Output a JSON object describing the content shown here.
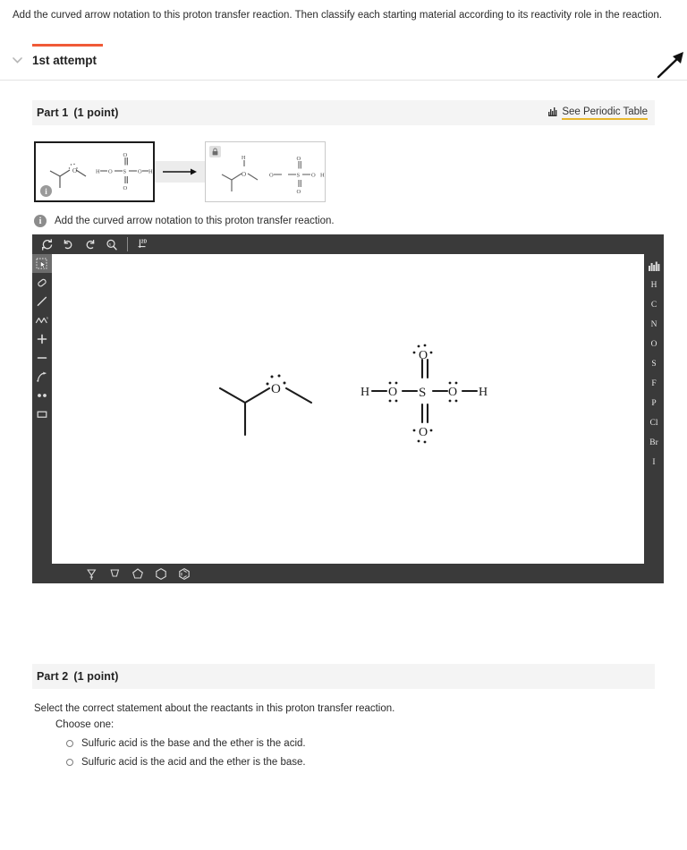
{
  "prompt": {
    "text": "Add the curved arrow notation to this proton transfer reaction. Then classify each starting material according to its reactivity role in the reaction."
  },
  "attempt": {
    "label": "1st attempt",
    "chevron_icon": "chevron-down-icon",
    "expand_icon": "expand-arrow-icon",
    "accent_color": "#f05a37"
  },
  "part1": {
    "title": "Part 1",
    "points": "(1 point)",
    "periodic_table_link": "See Periodic Table",
    "periodic_icon": "periodic-table-icon",
    "underline_color": "#e8b62c",
    "reaction": {
      "reactant_badge_icon": "info-icon",
      "reactant_badge_char": "i",
      "arrow_icon": "reaction-arrow-icon",
      "product_badge_icon": "lock-icon"
    },
    "instruction": {
      "icon": "info-icon",
      "icon_char": "i",
      "text": "Add the curved arrow notation to this proton transfer reaction."
    },
    "editor": {
      "toolbar": [
        {
          "name": "reset-tool",
          "icon": "refresh-icon",
          "title": "Reset"
        },
        {
          "name": "undo-tool",
          "icon": "undo-icon",
          "title": "Undo"
        },
        {
          "name": "redo-tool",
          "icon": "redo-icon",
          "title": "Redo"
        },
        {
          "name": "zoom-reset-tool",
          "icon": "zoom-reset-icon",
          "title": "Reset Zoom"
        },
        {
          "name": "view-2d-tool",
          "icon": "2d-axes-icon",
          "title": "2D",
          "label": "2D"
        }
      ],
      "tools": [
        {
          "name": "select-tool",
          "icon": "marquee-select-icon",
          "active": true
        },
        {
          "name": "eraser-tool",
          "icon": "eraser-icon",
          "active": false
        },
        {
          "name": "single-bond-tool",
          "icon": "single-bond-icon",
          "active": false
        },
        {
          "name": "chain-tool",
          "icon": "zigzag-chain-icon",
          "active": false
        },
        {
          "name": "increase-charge-tool",
          "icon": "plus-icon",
          "active": false
        },
        {
          "name": "decrease-charge-tool",
          "icon": "minus-icon",
          "active": false
        },
        {
          "name": "curved-arrow-tool",
          "icon": "curved-arrow-icon",
          "active": false
        },
        {
          "name": "lone-pair-tool",
          "icon": "lone-pair-dots-icon",
          "active": false
        },
        {
          "name": "rectangle-tool",
          "icon": "rectangle-icon",
          "active": false
        }
      ],
      "elements": [
        {
          "name": "periodic-table-button",
          "icon": "periodic-table-icon",
          "label": ""
        },
        {
          "name": "element-h",
          "label": "H"
        },
        {
          "name": "element-c",
          "label": "C"
        },
        {
          "name": "element-n",
          "label": "N"
        },
        {
          "name": "element-o",
          "label": "O"
        },
        {
          "name": "element-s",
          "label": "S"
        },
        {
          "name": "element-f",
          "label": "F"
        },
        {
          "name": "element-p",
          "label": "P"
        },
        {
          "name": "element-cl",
          "label": "Cl"
        },
        {
          "name": "element-br",
          "label": "Br"
        },
        {
          "name": "element-i",
          "label": "I"
        }
      ],
      "rings": [
        {
          "name": "ring-3-tool",
          "icon": "cyclopropane-icon"
        },
        {
          "name": "ring-4-tool",
          "icon": "cyclobutane-icon"
        },
        {
          "name": "ring-5-tool",
          "icon": "cyclopentane-icon"
        },
        {
          "name": "ring-6-tool",
          "icon": "cyclohexane-icon"
        },
        {
          "name": "benzene-tool",
          "icon": "benzene-icon"
        }
      ],
      "canvas_molecules": {
        "ether": {
          "name": "isopropyl-methyl-ether",
          "atom_label": "O",
          "lone_pairs": 2
        },
        "sulfuric_acid": {
          "name": "sulfuric-acid",
          "center_label": "S",
          "top_oxygen": "O",
          "bottom_oxygen": "O",
          "left_oxygen": "O",
          "right_oxygen": "O",
          "left_hydrogen": "H",
          "right_hydrogen": "H"
        }
      }
    }
  },
  "part2": {
    "title": "Part 2",
    "points": "(1 point)",
    "question": "Select the correct statement about the reactants in this proton transfer reaction.",
    "choose_label": "Choose one:",
    "choices": [
      "Sulfuric acid is the base and the ether is the acid.",
      "Sulfuric acid is the acid and the ether is the base."
    ]
  }
}
